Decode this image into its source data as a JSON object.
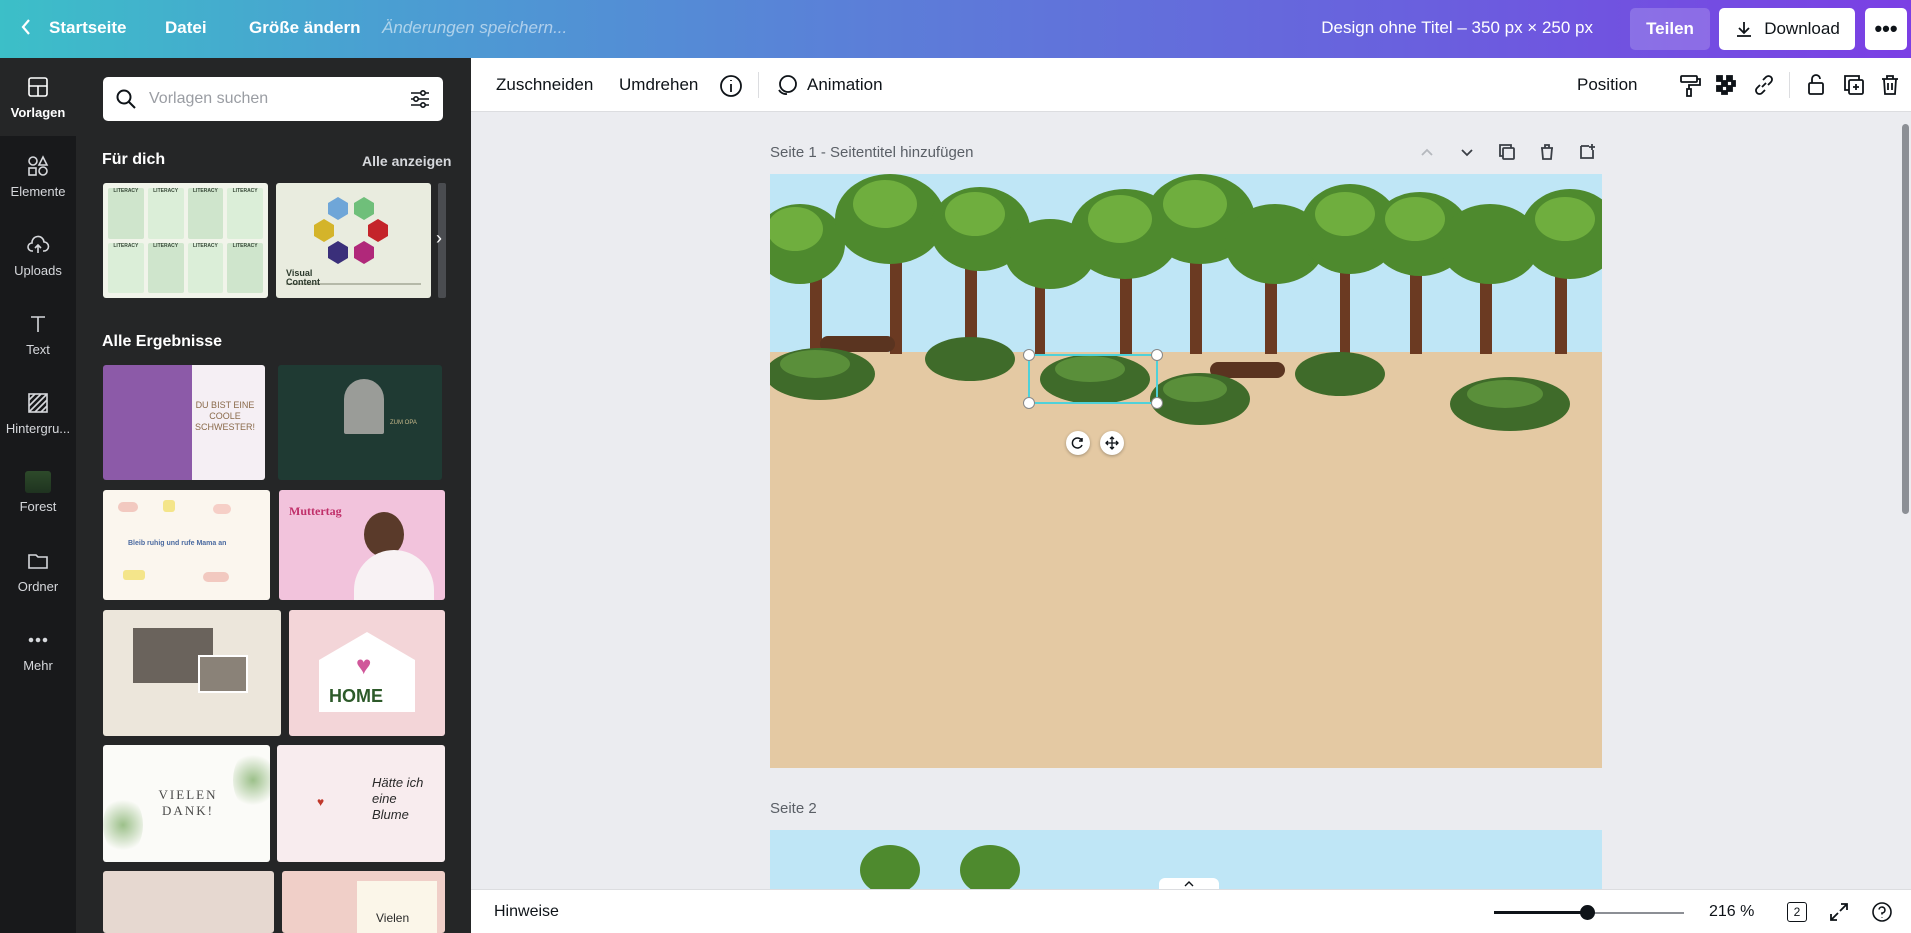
{
  "topbar": {
    "home": "Startseite",
    "file": "Datei",
    "resize": "Größe ändern",
    "save_status": "Änderungen speichern...",
    "design_title": "Design ohne Titel – 350 px × 250 px",
    "share": "Teilen",
    "download": "Download",
    "more": "•••"
  },
  "rail": {
    "items": [
      {
        "label": "Vorlagen",
        "icon": "templates-icon"
      },
      {
        "label": "Elemente",
        "icon": "elements-icon"
      },
      {
        "label": "Uploads",
        "icon": "cloud-upload-icon"
      },
      {
        "label": "Text",
        "icon": "text-icon"
      },
      {
        "label": "Hintergru...",
        "icon": "background-icon"
      },
      {
        "label": "Forest",
        "icon": "forest-thumbnail-icon"
      },
      {
        "label": "Ordner",
        "icon": "folder-icon"
      },
      {
        "label": "Mehr",
        "icon": "more-dots-icon"
      }
    ]
  },
  "panel": {
    "search_placeholder": "Vorlagen suchen",
    "for_you": "Für dich",
    "show_all": "Alle anzeigen",
    "all_results": "Alle Ergebnisse",
    "template_texts": {
      "visual_content": "Visual Content",
      "literacy": "LITERACY",
      "du_bist": "DU BIST EINE COOLE SCHWESTER!",
      "zum_opa": "ZUM OPA",
      "bleib_ruhig": "Bleib ruhig und rufe Mama an",
      "muttertag": "Muttertag",
      "home": "HOME",
      "vielen_dank": "VIELEN DANK!",
      "haette_blume": "Hätte ich eine Blume",
      "vielen": "Vielen"
    }
  },
  "context_toolbar": {
    "crop": "Zuschneiden",
    "flip": "Umdrehen",
    "animation": "Animation",
    "position": "Position"
  },
  "canvas": {
    "page1_label": "Seite 1 - Seitentitel hinzufügen",
    "page2_label": "Seite 2"
  },
  "bottombar": {
    "hints": "Hinweise",
    "zoom": "216 %",
    "zoom_level": 0.49,
    "page_count": "2"
  },
  "colors": {
    "sky": "#bfe6f6",
    "ground": "#e4c9a3",
    "accent_selection": "#4fd1d9"
  }
}
